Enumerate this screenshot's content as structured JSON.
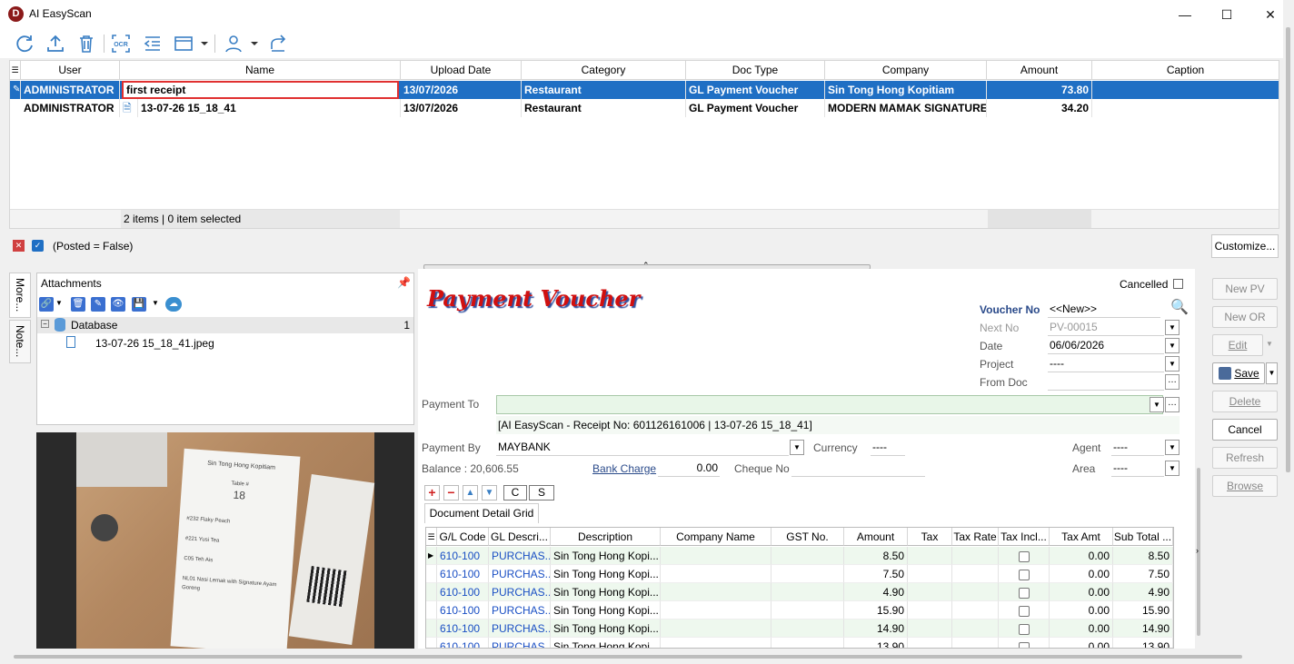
{
  "window": {
    "title": "AI EasyScan",
    "logo_letter": "D",
    "minimize": "—",
    "maximize": "☐",
    "close": "✕"
  },
  "toolbar": {
    "icons": [
      "refresh-icon",
      "upload-icon",
      "trash-icon",
      "ocr-icon",
      "indent-icon",
      "layout-icon",
      "user-icon",
      "share-icon"
    ],
    "ocr_label": "OCR"
  },
  "grid": {
    "columns": [
      "User",
      "Name",
      "Upload Date",
      "Category",
      "Doc Type",
      "Company",
      "Amount",
      "Caption"
    ],
    "rows": [
      {
        "user": "ADMINISTRATOR",
        "name": "first receipt",
        "upload_date": "13/07/2026",
        "category": "Restaurant",
        "doc_type": "GL Payment Voucher",
        "company": "Sin Tong Hong Kopitiam",
        "amount": "73.80",
        "caption": ""
      },
      {
        "user": "ADMINISTRATOR",
        "name": "13-07-26 15_18_41",
        "upload_date": "13/07/2026",
        "category": "Restaurant",
        "doc_type": "GL Payment Voucher",
        "company": "MODERN MAMAK SIGNATURE",
        "amount": "34.20",
        "caption": ""
      }
    ],
    "footer_count": "2 items |  0 item selected"
  },
  "filter": {
    "text": "(Posted = False)",
    "customize": "Customize..."
  },
  "side_tabs": [
    "More...",
    "Note..."
  ],
  "attachments": {
    "title": "Attachments",
    "tree_root": "Database",
    "tree_root_count": "1",
    "file_name": "13-07-26 15_18_41.jpeg"
  },
  "receipt": {
    "shop": "Sin Tong Hong Kopitiam",
    "table_label": "Table #",
    "table_no": "18",
    "items": [
      "#232 Flaky Peach",
      "#221 Yusi Tea",
      "C05 Teh Ais",
      "NL01 Nasi Lemak with Signature Ayam Goreng"
    ]
  },
  "voucher": {
    "title": "Payment Voucher",
    "cancelled_label": "Cancelled",
    "voucher_no_label": "Voucher No",
    "voucher_no": "<<New>>",
    "next_no_label": "Next No",
    "next_no": "PV-00015",
    "date_label": "Date",
    "date": "06/06/2026",
    "project_label": "Project",
    "project": "----",
    "from_doc_label": "From Doc",
    "payment_to_label": "Payment To",
    "payment_to": "",
    "description": "[AI EasyScan - Receipt No: 601126161006 | 13-07-26 15_18_41]",
    "payment_by_label": "Payment By",
    "payment_by": "MAYBANK",
    "currency_label": "Currency",
    "currency": "----",
    "agent_label": "Agent",
    "agent": "----",
    "balance": "Balance :  20,606.55",
    "bank_charge_label": "Bank Charge",
    "bank_charge": "0.00",
    "cheque_no_label": "Cheque No",
    "area_label": "Area",
    "area": "----",
    "c_button": "C",
    "s_button": "S",
    "detail_tab": "Document Detail Grid"
  },
  "side_buttons": {
    "new_pv": "New PV",
    "new_or": "New OR",
    "edit": "Edit",
    "save": "Save",
    "delete": "Delete",
    "cancel": "Cancel",
    "refresh": "Refresh",
    "browse": "Browse"
  },
  "detail": {
    "columns": [
      "G/L Code",
      "GL Descri...",
      "Description",
      "Company Name",
      "GST No.",
      "Amount",
      "Tax",
      "Tax Rate",
      "Tax Incl...",
      "Tax Amt",
      "Sub Total ..."
    ],
    "rows": [
      {
        "gl": "610-100",
        "gldesc": "PURCHAS...",
        "desc": "Sin Tong Hong Kopi...",
        "amount": "8.50",
        "taxamt": "0.00",
        "subtotal": "8.50"
      },
      {
        "gl": "610-100",
        "gldesc": "PURCHAS...",
        "desc": "Sin Tong Hong Kopi...",
        "amount": "7.50",
        "taxamt": "0.00",
        "subtotal": "7.50"
      },
      {
        "gl": "610-100",
        "gldesc": "PURCHAS...",
        "desc": "Sin Tong Hong Kopi...",
        "amount": "4.90",
        "taxamt": "0.00",
        "subtotal": "4.90"
      },
      {
        "gl": "610-100",
        "gldesc": "PURCHAS...",
        "desc": "Sin Tong Hong Kopi...",
        "amount": "15.90",
        "taxamt": "0.00",
        "subtotal": "15.90"
      },
      {
        "gl": "610-100",
        "gldesc": "PURCHAS...",
        "desc": "Sin Tong Hong Kopi...",
        "amount": "14.90",
        "taxamt": "0.00",
        "subtotal": "14.90"
      },
      {
        "gl": "610-100",
        "gldesc": "PURCHAS...",
        "desc": "Sin Tong Hong Kopi...",
        "amount": "13.90",
        "taxamt": "0.00",
        "subtotal": "13.90"
      }
    ]
  },
  "colors": {
    "selection": "#1f6fc4",
    "title_red": "#d01010",
    "link_blue": "#1a4fc4",
    "edit_border": "#e03030"
  }
}
